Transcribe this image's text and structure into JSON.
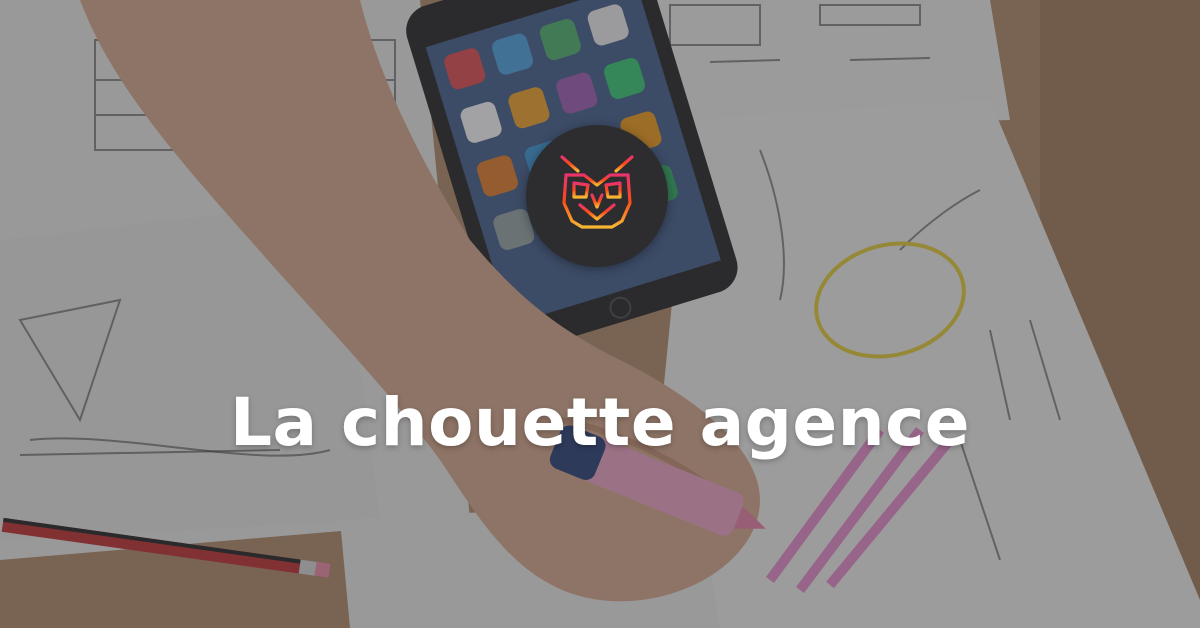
{
  "headline": "La chouette agence",
  "logo": {
    "icon": "owl-icon",
    "colors": [
      "#f7b733",
      "#fc4a1a",
      "#e8336d"
    ]
  },
  "background": {
    "description_icon": "photo-sketching-wireframes"
  }
}
